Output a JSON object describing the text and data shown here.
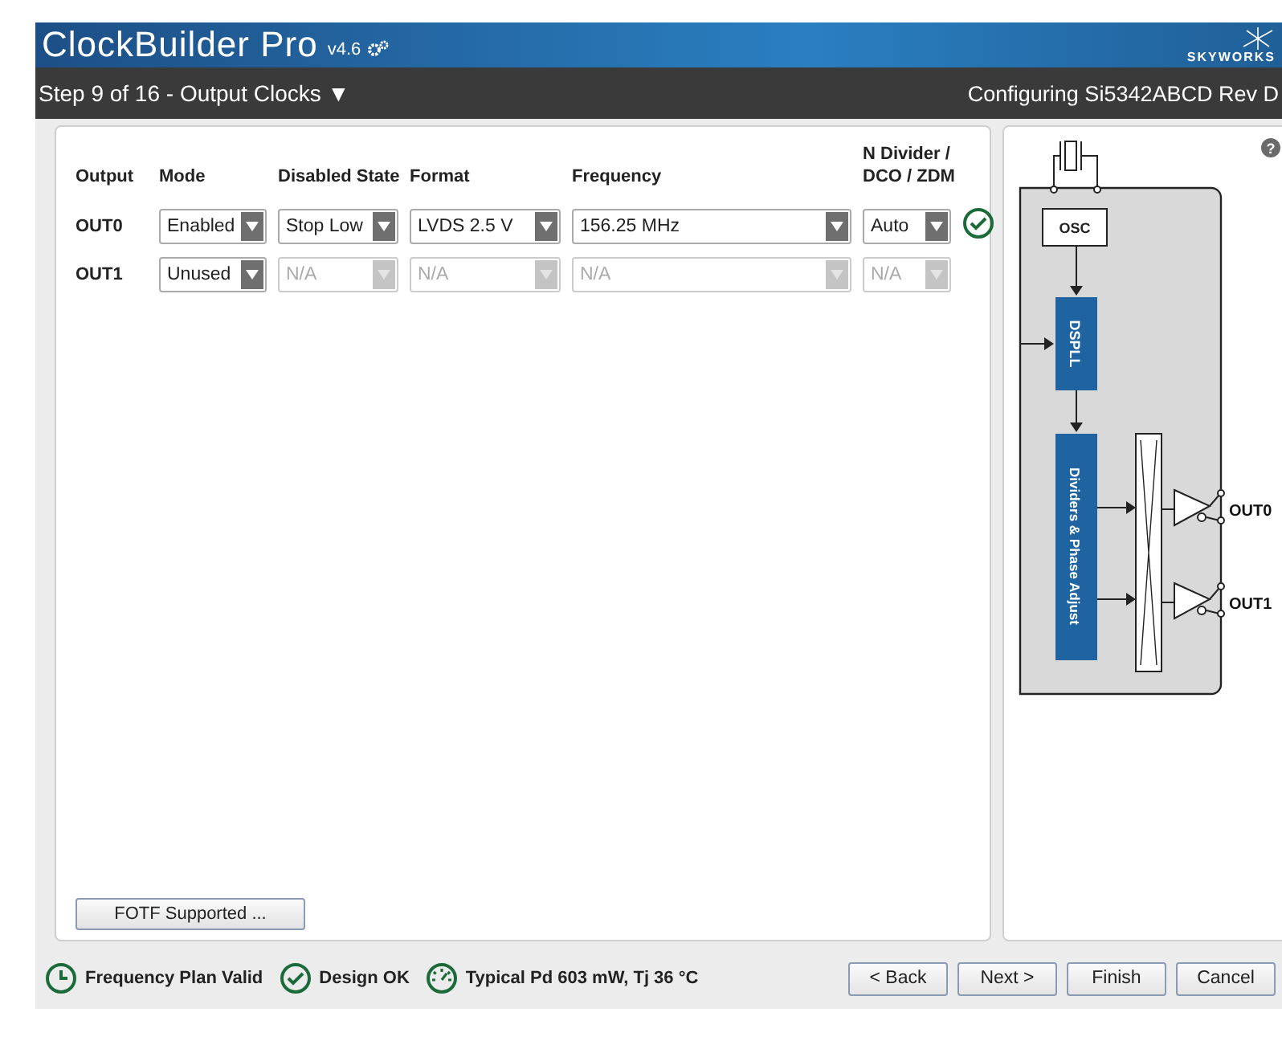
{
  "app": {
    "title": "ClockBuilder Pro",
    "version": "v4.6",
    "brand": "SKYWORKS"
  },
  "step_bar": {
    "step": "Step 9 of 16 - Output Clocks ▼",
    "configuring": "Configuring Si5342ABCD Rev D"
  },
  "table": {
    "columns": [
      {
        "label": "Output"
      },
      {
        "label": "Mode"
      },
      {
        "label": "Disabled State"
      },
      {
        "label": "Format"
      },
      {
        "label": "Frequency"
      },
      {
        "label": "N Divider / DCO / ZDM"
      }
    ],
    "rows": [
      {
        "output": "OUT0",
        "valid": true,
        "fields": [
          {
            "value": "Enabled",
            "disabled": false
          },
          {
            "value": "Stop Low",
            "disabled": false
          },
          {
            "value": "LVDS 2.5 V",
            "disabled": false
          },
          {
            "value": "156.25 MHz",
            "disabled": false
          },
          {
            "value": "Auto",
            "disabled": false
          }
        ]
      },
      {
        "output": "OUT1",
        "valid": false,
        "fields": [
          {
            "value": "Unused",
            "disabled": false
          },
          {
            "value": "N/A",
            "disabled": true
          },
          {
            "value": "N/A",
            "disabled": true
          },
          {
            "value": "N/A",
            "disabled": true
          },
          {
            "value": "N/A",
            "disabled": true
          }
        ]
      }
    ]
  },
  "fotf_button": "FOTF Supported ...",
  "diagram": {
    "osc": "OSC",
    "pll": "DSPLL",
    "dividers": "Dividers & Phase Adjust",
    "outputs": [
      "OUT0",
      "OUT1"
    ],
    "help": "?"
  },
  "status": [
    {
      "kind": "clock",
      "label": "Frequency Plan Valid"
    },
    {
      "kind": "check",
      "label": "Design OK"
    },
    {
      "kind": "gauge",
      "label": "Typical Pd 603 mW, Tj 36 °C"
    }
  ],
  "buttons": [
    "< Back",
    "Next >",
    "Finish",
    "Cancel"
  ]
}
